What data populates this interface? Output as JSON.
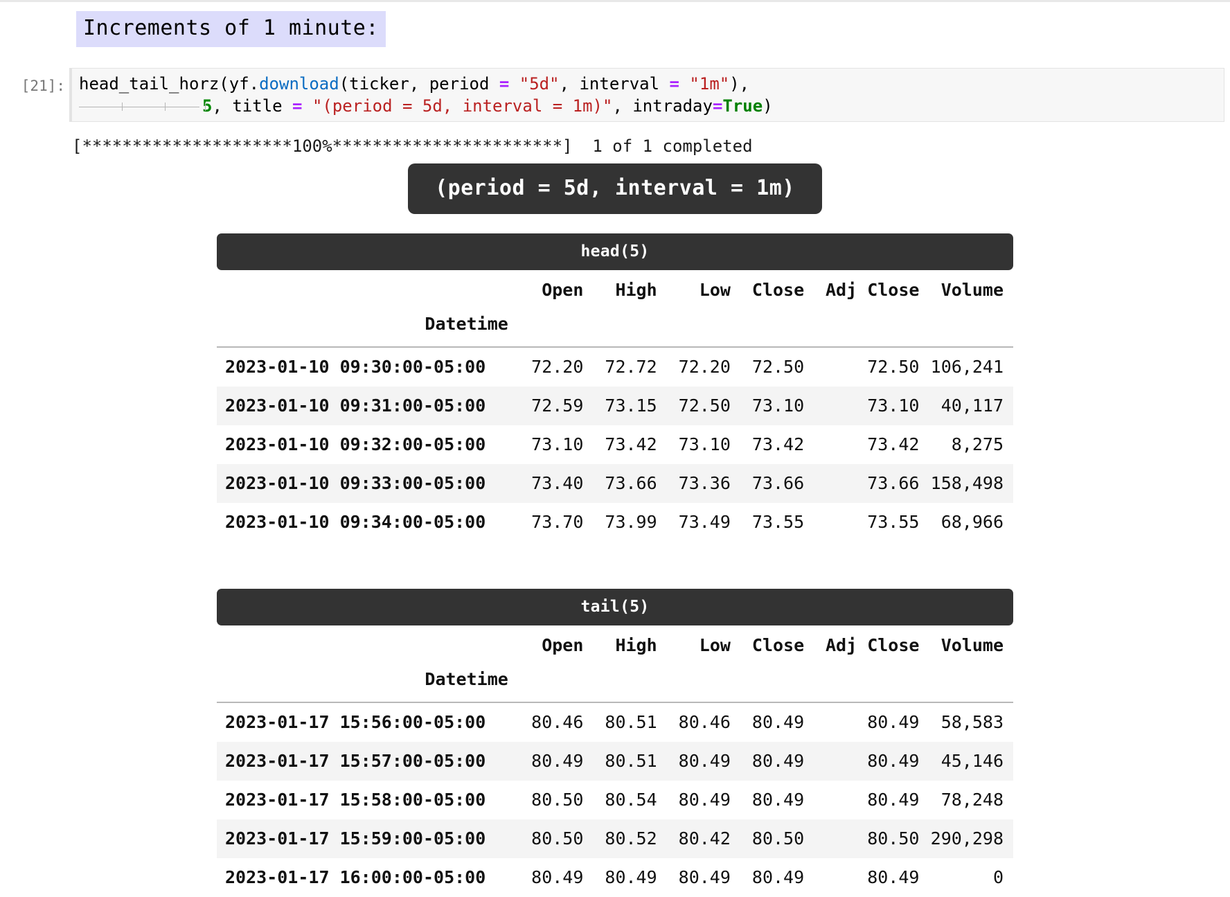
{
  "markdown": {
    "heading": "Increments of 1 minute:",
    "highlight_color": "#dcdcfb"
  },
  "cell": {
    "prompt": "[21]:",
    "code_line1": {
      "fn": "head_tail_horz(yf.",
      "download": "download",
      "args_a": "(ticker, period ",
      "eq1": "=",
      "str1": " \"5d\"",
      "args_b": ", interval ",
      "eq2": "=",
      "str2": " \"1m\"",
      "tail": "),"
    },
    "code_line2": {
      "num": "5",
      "mid": ", title ",
      "eq": "=",
      "str": " \"(period = 5d, interval = 1m)\"",
      "kwarg": ", intraday",
      "eq2": "=",
      "kw": "True",
      "close": ")"
    }
  },
  "stdout": {
    "progress": "[*********************100%***********************]  1 of 1 completed"
  },
  "output": {
    "title": "(period = 5d, interval = 1m)",
    "banner_bg": "#333333",
    "head": {
      "section_label": "head(5)",
      "index_name": "Datetime",
      "columns": [
        "Open",
        "High",
        "Low",
        "Close",
        "Adj Close",
        "Volume"
      ],
      "rows": [
        {
          "index": "2023-01-10 09:30:00-05:00",
          "open": "72.20",
          "high": "72.72",
          "low": "72.20",
          "close": "72.50",
          "adj_close": "72.50",
          "volume": "106,241"
        },
        {
          "index": "2023-01-10 09:31:00-05:00",
          "open": "72.59",
          "high": "73.15",
          "low": "72.50",
          "close": "73.10",
          "adj_close": "73.10",
          "volume": "40,117"
        },
        {
          "index": "2023-01-10 09:32:00-05:00",
          "open": "73.10",
          "high": "73.42",
          "low": "73.10",
          "close": "73.42",
          "adj_close": "73.42",
          "volume": "8,275"
        },
        {
          "index": "2023-01-10 09:33:00-05:00",
          "open": "73.40",
          "high": "73.66",
          "low": "73.36",
          "close": "73.66",
          "adj_close": "73.66",
          "volume": "158,498"
        },
        {
          "index": "2023-01-10 09:34:00-05:00",
          "open": "73.70",
          "high": "73.99",
          "low": "73.49",
          "close": "73.55",
          "adj_close": "73.55",
          "volume": "68,966"
        }
      ]
    },
    "tail": {
      "section_label": "tail(5)",
      "index_name": "Datetime",
      "columns": [
        "Open",
        "High",
        "Low",
        "Close",
        "Adj Close",
        "Volume"
      ],
      "rows": [
        {
          "index": "2023-01-17 15:56:00-05:00",
          "open": "80.46",
          "high": "80.51",
          "low": "80.46",
          "close": "80.49",
          "adj_close": "80.49",
          "volume": "58,583"
        },
        {
          "index": "2023-01-17 15:57:00-05:00",
          "open": "80.49",
          "high": "80.51",
          "low": "80.49",
          "close": "80.49",
          "adj_close": "80.49",
          "volume": "45,146"
        },
        {
          "index": "2023-01-17 15:58:00-05:00",
          "open": "80.50",
          "high": "80.54",
          "low": "80.49",
          "close": "80.49",
          "adj_close": "80.49",
          "volume": "78,248"
        },
        {
          "index": "2023-01-17 15:59:00-05:00",
          "open": "80.50",
          "high": "80.52",
          "low": "80.42",
          "close": "80.50",
          "adj_close": "80.50",
          "volume": "290,298"
        },
        {
          "index": "2023-01-17 16:00:00-05:00",
          "open": "80.49",
          "high": "80.49",
          "low": "80.49",
          "close": "80.49",
          "adj_close": "80.49",
          "volume": "0"
        }
      ]
    }
  },
  "chart_data": {
    "type": "table",
    "title": "(period = 5d, interval = 1m)",
    "tables": [
      {
        "name": "head(5)",
        "index_name": "Datetime",
        "columns": [
          "Open",
          "High",
          "Low",
          "Close",
          "Adj Close",
          "Volume"
        ],
        "index": [
          "2023-01-10 09:30:00-05:00",
          "2023-01-10 09:31:00-05:00",
          "2023-01-10 09:32:00-05:00",
          "2023-01-10 09:33:00-05:00",
          "2023-01-10 09:34:00-05:00"
        ],
        "values": [
          [
            72.2,
            72.72,
            72.2,
            72.5,
            72.5,
            106241
          ],
          [
            72.59,
            73.15,
            72.5,
            73.1,
            73.1,
            40117
          ],
          [
            73.1,
            73.42,
            73.1,
            73.42,
            73.42,
            8275
          ],
          [
            73.4,
            73.66,
            73.36,
            73.66,
            73.66,
            158498
          ],
          [
            73.7,
            73.99,
            73.49,
            73.55,
            73.55,
            68966
          ]
        ]
      },
      {
        "name": "tail(5)",
        "index_name": "Datetime",
        "columns": [
          "Open",
          "High",
          "Low",
          "Close",
          "Adj Close",
          "Volume"
        ],
        "index": [
          "2023-01-17 15:56:00-05:00",
          "2023-01-17 15:57:00-05:00",
          "2023-01-17 15:58:00-05:00",
          "2023-01-17 15:59:00-05:00",
          "2023-01-17 16:00:00-05:00"
        ],
        "values": [
          [
            80.46,
            80.51,
            80.46,
            80.49,
            80.49,
            58583
          ],
          [
            80.49,
            80.51,
            80.49,
            80.49,
            80.49,
            45146
          ],
          [
            80.5,
            80.54,
            80.49,
            80.49,
            80.49,
            78248
          ],
          [
            80.5,
            80.52,
            80.42,
            80.5,
            80.5,
            290298
          ],
          [
            80.49,
            80.49,
            80.49,
            80.49,
            80.49,
            0
          ]
        ]
      }
    ]
  }
}
